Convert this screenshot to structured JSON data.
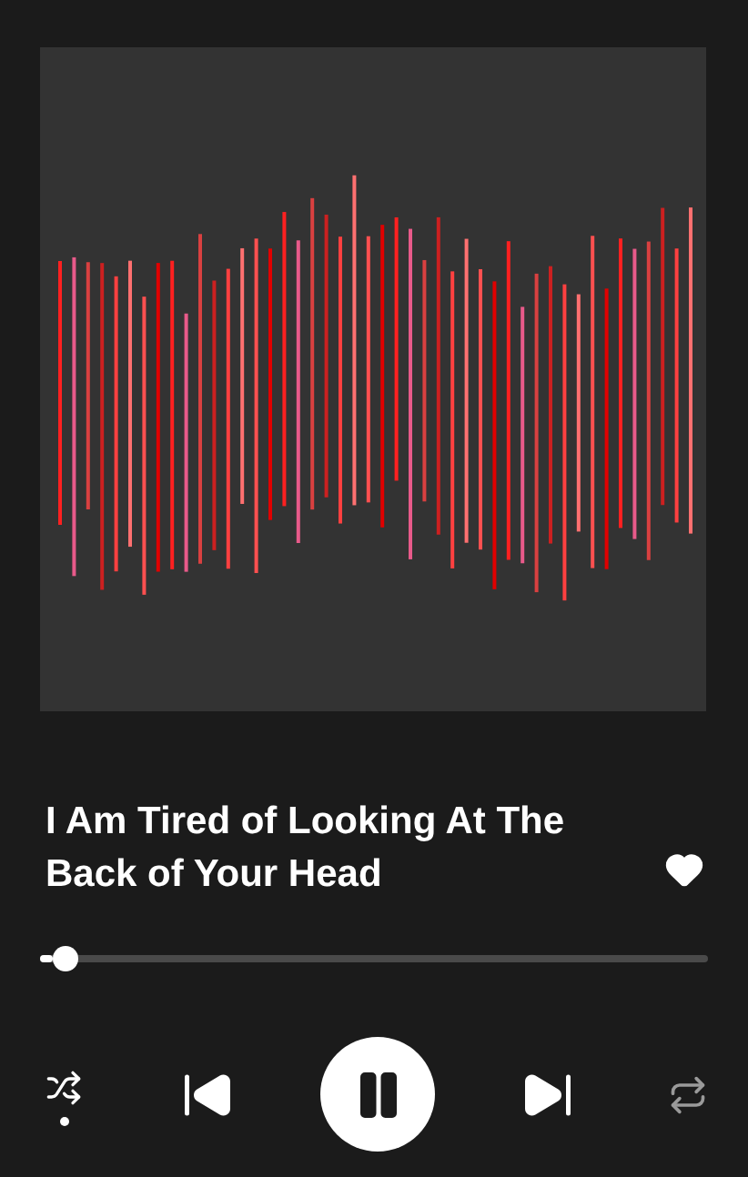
{
  "track": {
    "title": "I Am Tired of Looking At The Back of Your Head",
    "liked": true
  },
  "progress": {
    "level": 0.02
  },
  "controls": {
    "shuffle": true,
    "playing": true,
    "repeat": false
  }
}
